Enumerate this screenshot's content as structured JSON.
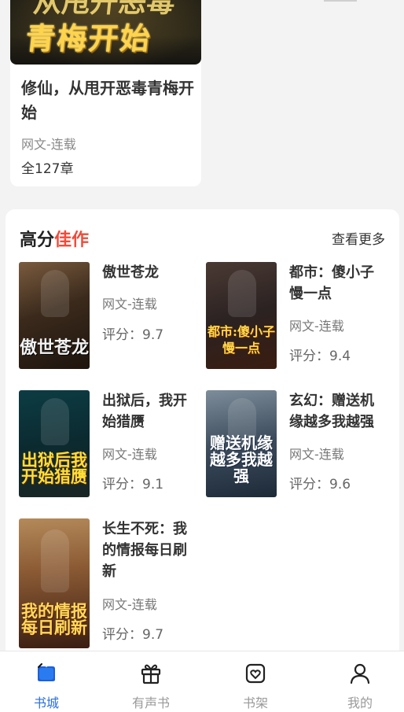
{
  "top_book": {
    "cover_text_line1": "从甩开恶毒",
    "cover_text_line2": "青梅开始",
    "title": "修仙，从甩开恶毒青梅开始",
    "meta": "网文-连载",
    "chapters": "全127章"
  },
  "section": {
    "title_part1": "高分",
    "title_part2": "佳作",
    "more": "查看更多",
    "books": [
      {
        "cover_text": "傲世苍龙",
        "title": "傲世苍龙",
        "meta": "网文-连载",
        "score": "评分：9.7"
      },
      {
        "cover_text": "都市:傻小子慢一点",
        "title": "都市：傻小子慢一点",
        "meta": "网文-连载",
        "score": "评分：9.4"
      },
      {
        "cover_text": "出狱后我开始猎赝",
        "title": "出狱后，我开始猎赝",
        "meta": "网文-连载",
        "score": "评分：9.1"
      },
      {
        "cover_text": "赠送机缘越多我越强",
        "title": "玄幻：赠送机缘越多我越强",
        "meta": "网文-连载",
        "score": "评分：9.6"
      },
      {
        "cover_text": "我的情报每日刷新",
        "title": "长生不死：我的情报每日刷新",
        "meta": "网文-连载",
        "score": "评分：9.7"
      }
    ]
  },
  "nav": {
    "items": [
      {
        "label": "书城",
        "icon": "bookstore-icon",
        "active": true
      },
      {
        "label": "有声书",
        "icon": "gift-icon",
        "active": false
      },
      {
        "label": "书架",
        "icon": "bookshelf-heart-icon",
        "active": false
      },
      {
        "label": "我的",
        "icon": "profile-icon",
        "active": false
      }
    ]
  },
  "colors": {
    "accent": "#f04b3a",
    "active_nav": "#2a6fdb"
  }
}
